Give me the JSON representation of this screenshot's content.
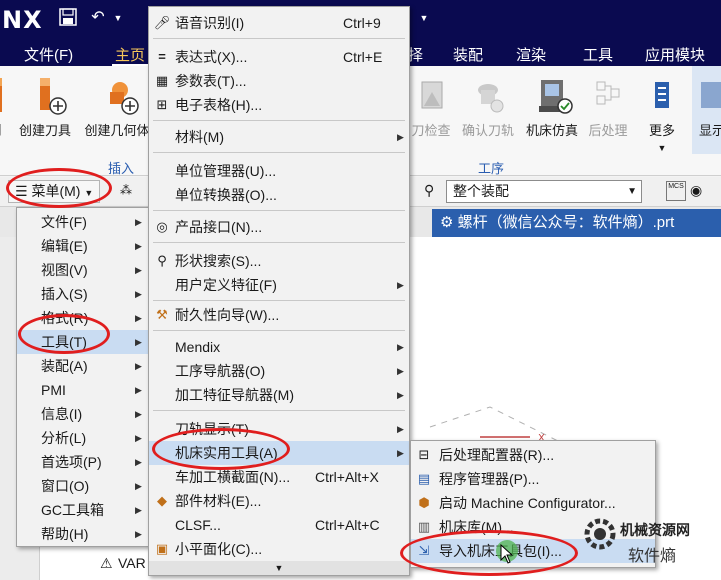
{
  "titlebar": {
    "logo": "NX"
  },
  "ribbon_tabs": [
    "文件(F)",
    "主页",
    "择",
    "装配",
    "渲染",
    "工具",
    "应用模块"
  ],
  "ribbon": {
    "left_cut": "削",
    "create_tool": "创建刀具",
    "create_geometry": "创建几何体",
    "insert_group": "插入",
    "check": "刀检查",
    "confirm_path": "确认刀轨",
    "machine_sim": "机床仿真",
    "postprocess": "后处理",
    "more": "更多",
    "display": "显示",
    "operation_group": "工序"
  },
  "selbar": {
    "menu_button": "菜单(M)",
    "filter_value": "整个装配"
  },
  "doc_tab": "螺杆（微信公众号：软件熵）.prt",
  "main_menu": [
    {
      "label": "文件(F)",
      "sub": true
    },
    {
      "label": "编辑(E)",
      "sub": true
    },
    {
      "label": "视图(V)",
      "sub": true
    },
    {
      "label": "插入(S)",
      "sub": true
    },
    {
      "label": "格式(R)",
      "sub": true
    },
    {
      "label": "工具(T)",
      "sub": true
    },
    {
      "label": "装配(A)",
      "sub": true
    },
    {
      "label": "PMI",
      "sub": true
    },
    {
      "label": "信息(I)",
      "sub": true
    },
    {
      "label": "分析(L)",
      "sub": true
    },
    {
      "label": "首选项(P)",
      "sub": true
    },
    {
      "label": "窗口(O)",
      "sub": true
    },
    {
      "label": "GC工具箱",
      "sub": true
    },
    {
      "label": "帮助(H)",
      "sub": true
    }
  ],
  "tools_menu": [
    {
      "label": "语音识别(I)",
      "shortcut": "Ctrl+9",
      "icon": "microphone-icon"
    },
    {
      "label": "表达式(X)...",
      "shortcut": "Ctrl+E",
      "icon": "equals-icon"
    },
    {
      "label": "参数表(T)...",
      "shortcut": "",
      "icon": "table-icon"
    },
    {
      "label": "电子表格(H)...",
      "shortcut": "",
      "icon": "spreadsheet-icon"
    },
    {
      "label": "材料(M)",
      "shortcut": "",
      "icon": ""
    },
    {
      "label": "单位管理器(U)...",
      "shortcut": "",
      "icon": ""
    },
    {
      "label": "单位转换器(O)...",
      "shortcut": "",
      "icon": ""
    },
    {
      "label": "产品接口(N)...",
      "shortcut": "",
      "icon": "interface-icon"
    },
    {
      "label": "形状搜索(S)...",
      "shortcut": "",
      "icon": "shape-search-icon"
    },
    {
      "label": "用户定义特征(F)",
      "shortcut": "",
      "icon": ""
    },
    {
      "label": "耐久性向导(W)...",
      "shortcut": "",
      "icon": "durability-icon"
    },
    {
      "label": "Mendix",
      "shortcut": "",
      "icon": ""
    },
    {
      "label": "工序导航器(O)",
      "shortcut": "",
      "icon": ""
    },
    {
      "label": "加工特征导航器(M)",
      "shortcut": "",
      "icon": ""
    },
    {
      "label": "刀轨显示(T)",
      "shortcut": "",
      "icon": ""
    },
    {
      "label": "机床实用工具(A)",
      "shortcut": "",
      "icon": ""
    },
    {
      "label": "车加工横截面(N)...",
      "shortcut": "Ctrl+Alt+X",
      "icon": ""
    },
    {
      "label": "部件材料(E)...",
      "shortcut": "",
      "icon": "part-material-icon"
    },
    {
      "label": "CLSF...",
      "shortcut": "Ctrl+Alt+C",
      "icon": ""
    },
    {
      "label": "小平面化(C)...",
      "shortcut": "",
      "icon": "facet-icon"
    }
  ],
  "machine_menu": [
    {
      "label": "后处理配置器(R)...",
      "icon": "post-config-icon"
    },
    {
      "label": "程序管理器(P)...",
      "icon": "program-manager-icon"
    },
    {
      "label": "启动 Machine Configurator...",
      "icon": "machine-config-icon"
    },
    {
      "label": "机床库(M)...",
      "icon": "machine-library-icon"
    },
    {
      "label": "导入机床工具包(I)...",
      "icon": "import-toolkit-icon"
    }
  ],
  "workarea_snippet": "VAR",
  "watermark": {
    "line1": "机械资源网",
    "line2": "软件熵"
  },
  "colors": {
    "titlebar": "#0a0a50",
    "highlight": "#c9dcf2",
    "doc_tab": "#2b5fad",
    "annotation": "#e01e1e"
  }
}
